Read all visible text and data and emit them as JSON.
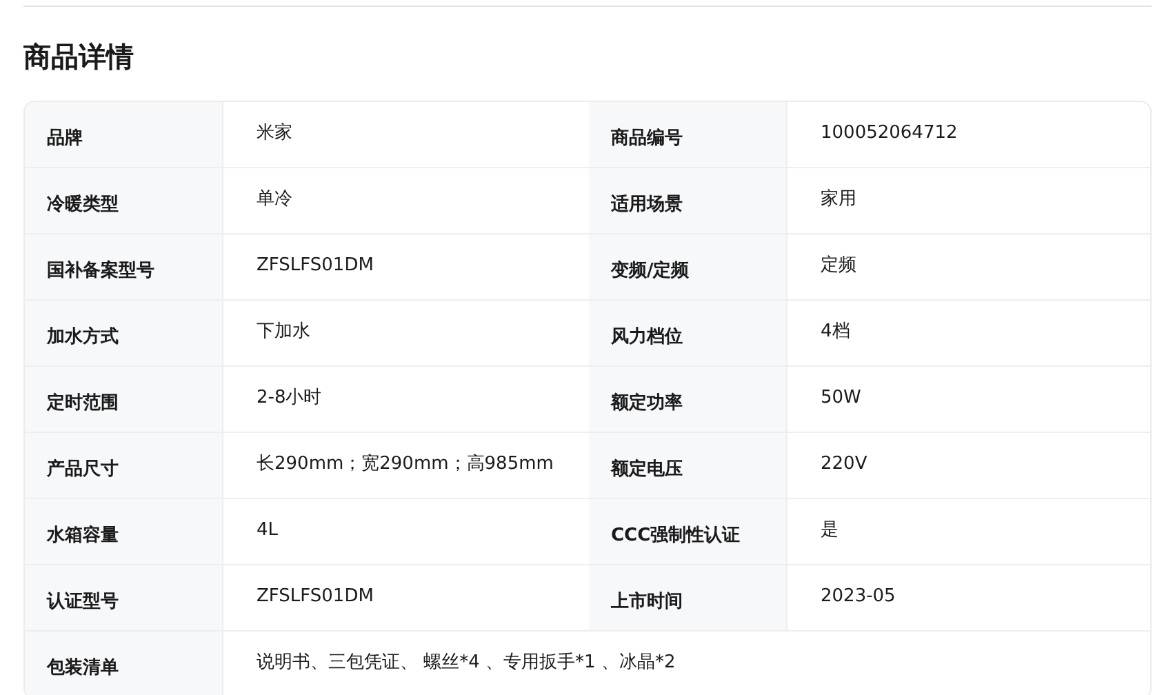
{
  "title": "商品详情",
  "rows": [
    {
      "cells": [
        {
          "label": "品牌",
          "value": "米家"
        },
        {
          "label": "商品编号",
          "value": "100052064712"
        }
      ]
    },
    {
      "cells": [
        {
          "label": "冷暖类型",
          "value": "单冷"
        },
        {
          "label": "适用场景",
          "value": "家用"
        }
      ]
    },
    {
      "cells": [
        {
          "label": "国补备案型号",
          "value": "ZFSLFS01DM"
        },
        {
          "label": "变频/定频",
          "value": "定频"
        }
      ]
    },
    {
      "cells": [
        {
          "label": "加水方式",
          "value": "下加水"
        },
        {
          "label": "风力档位",
          "value": "4档"
        }
      ]
    },
    {
      "cells": [
        {
          "label": "定时范围",
          "value": "2-8小时"
        },
        {
          "label": "额定功率",
          "value": "50W"
        }
      ]
    },
    {
      "cells": [
        {
          "label": "产品尺寸",
          "value": "长290mm；宽290mm；高985mm"
        },
        {
          "label": "额定电压",
          "value": "220V"
        }
      ]
    },
    {
      "cells": [
        {
          "label": "水箱容量",
          "value": "4L"
        },
        {
          "label": "CCC强制性认证",
          "value": "是"
        }
      ]
    },
    {
      "cells": [
        {
          "label": "认证型号",
          "value": "ZFSLFS01DM"
        },
        {
          "label": "上市时间",
          "value": "2023-05"
        }
      ]
    },
    {
      "cells": [
        {
          "label": "包装清单",
          "value": "说明书、三包凭证、 螺丝*4 、专用扳手*1 、冰晶*2"
        }
      ]
    }
  ]
}
